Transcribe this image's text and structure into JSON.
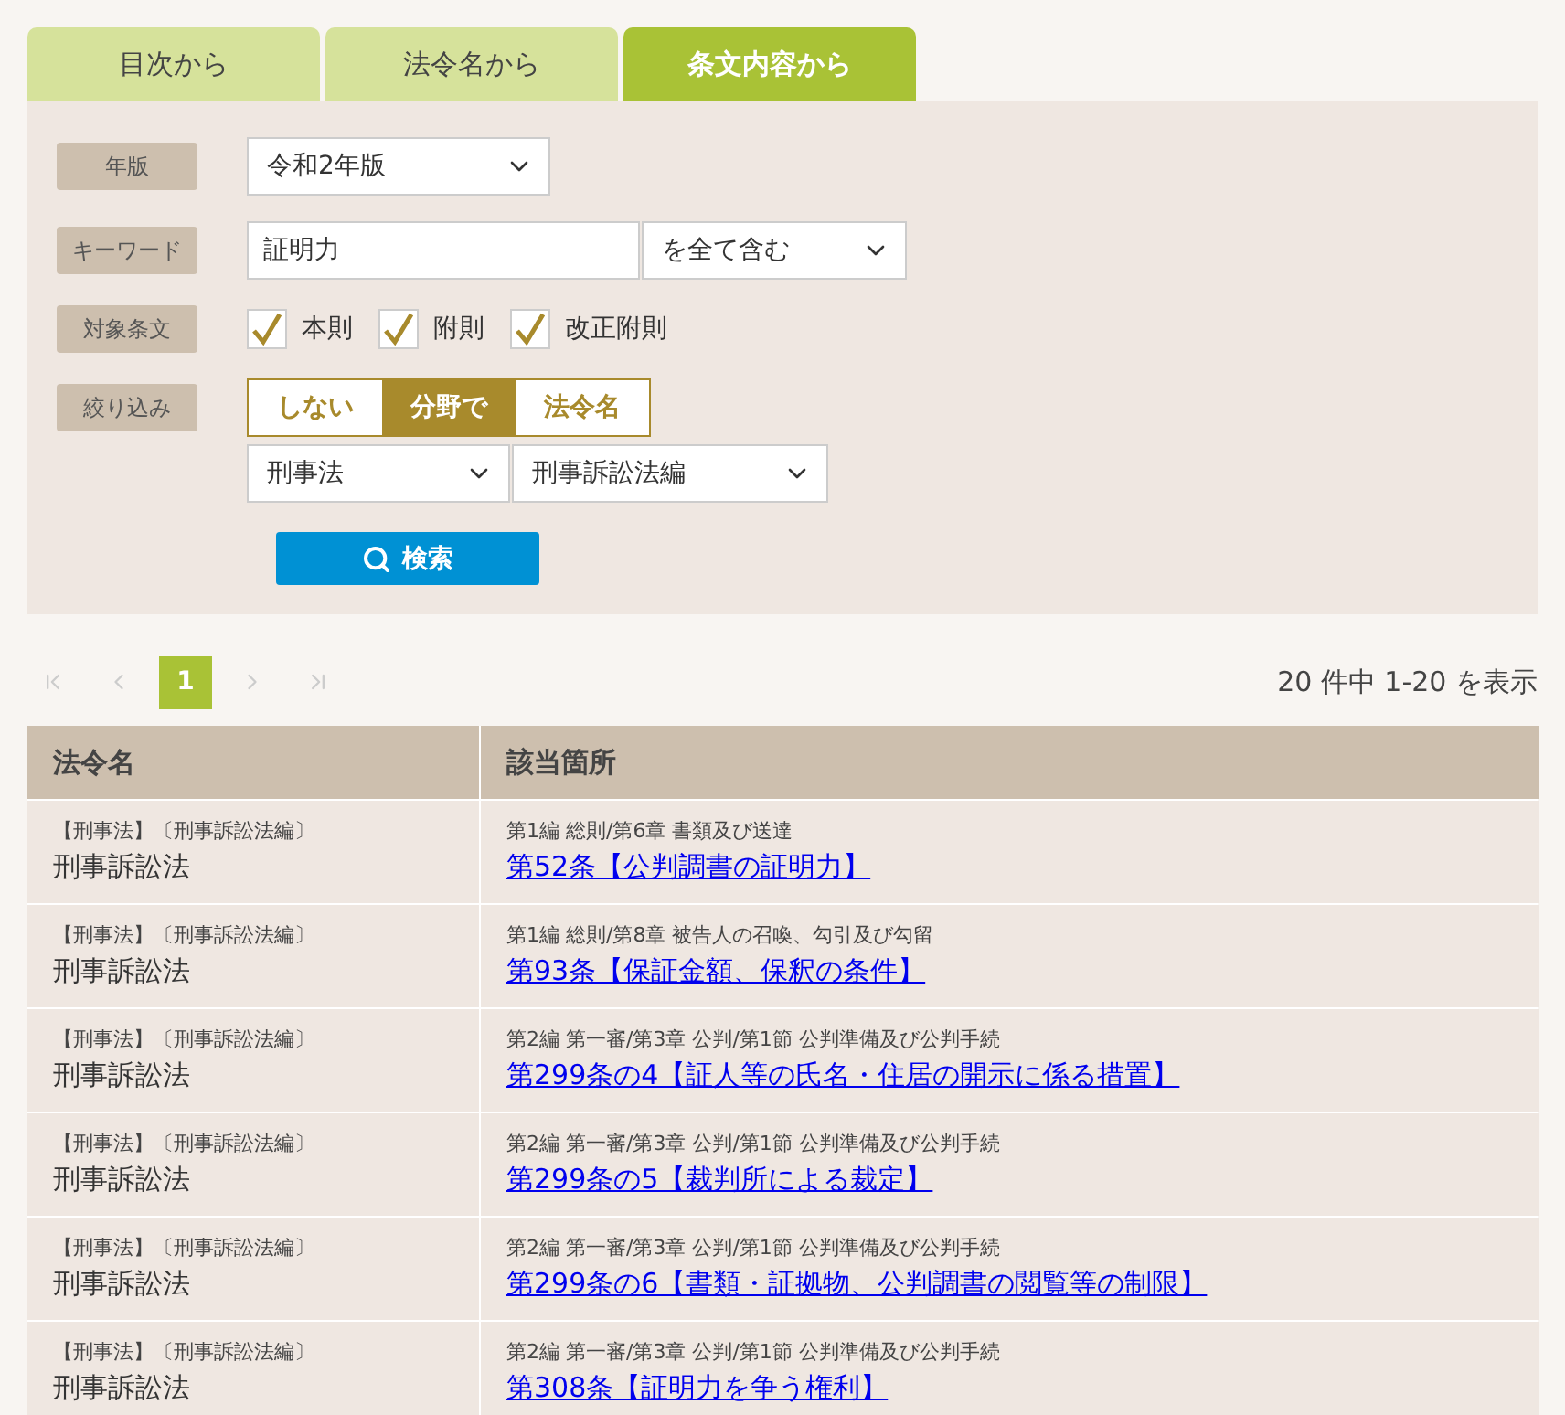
{
  "tabs": [
    {
      "label": "目次から",
      "selected": false
    },
    {
      "label": "法令名から",
      "selected": false
    },
    {
      "label": "条文内容から",
      "selected": true
    }
  ],
  "form": {
    "year": {
      "label": "年版",
      "value": "令和2年版"
    },
    "keyword": {
      "label": "キーワード",
      "value": "証明力",
      "mode": "を全て含む"
    },
    "target": {
      "label": "対象条文",
      "options": [
        {
          "label": "本則",
          "checked": true
        },
        {
          "label": "附則",
          "checked": true
        },
        {
          "label": "改正附則",
          "checked": true
        }
      ]
    },
    "filter": {
      "label": "絞り込み",
      "options": [
        {
          "label": "しない",
          "selected": false
        },
        {
          "label": "分野で",
          "selected": true
        },
        {
          "label": "法令名",
          "selected": false
        }
      ],
      "field": "刑事法",
      "subfield": "刑事訴訟法編"
    },
    "search_button": "検索"
  },
  "pager": {
    "first_disabled": true,
    "prev_disabled": true,
    "pages": [
      {
        "label": "1",
        "selected": true
      }
    ],
    "next_disabled": true,
    "last_disabled": true,
    "summary": "20 件中 1-20 を表示"
  },
  "table": {
    "columns": [
      "法令名",
      "該当箇所"
    ],
    "rows": [
      {
        "category": "【刑事法】〔刑事訴訟法編〕",
        "law": "刑事訴訟法",
        "path": "第1編 総則/第6章 書類及び送達",
        "article": "第52条【公判調書の証明力】"
      },
      {
        "category": "【刑事法】〔刑事訴訟法編〕",
        "law": "刑事訴訟法",
        "path": "第1編 総則/第8章 被告人の召喚、勾引及び勾留",
        "article": "第93条【保証金額、保釈の条件】"
      },
      {
        "category": "【刑事法】〔刑事訴訟法編〕",
        "law": "刑事訴訟法",
        "path": "第2編 第一審/第3章 公判/第1節 公判準備及び公判手続",
        "article": "第299条の4【証人等の氏名・住居の開示に係る措置】"
      },
      {
        "category": "【刑事法】〔刑事訴訟法編〕",
        "law": "刑事訴訟法",
        "path": "第2編 第一審/第3章 公判/第1節 公判準備及び公判手続",
        "article": "第299条の5【裁判所による裁定】"
      },
      {
        "category": "【刑事法】〔刑事訴訟法編〕",
        "law": "刑事訴訟法",
        "path": "第2編 第一審/第3章 公判/第1節 公判準備及び公判手続",
        "article": "第299条の6【書類・証拠物、公判調書の閲覧等の制限】"
      },
      {
        "category": "【刑事法】〔刑事訴訟法編〕",
        "law": "刑事訴訟法",
        "path": "第2編 第一審/第3章 公判/第1節 公判準備及び公判手続",
        "article": "第308条【証明力を争う権利】"
      }
    ]
  }
}
